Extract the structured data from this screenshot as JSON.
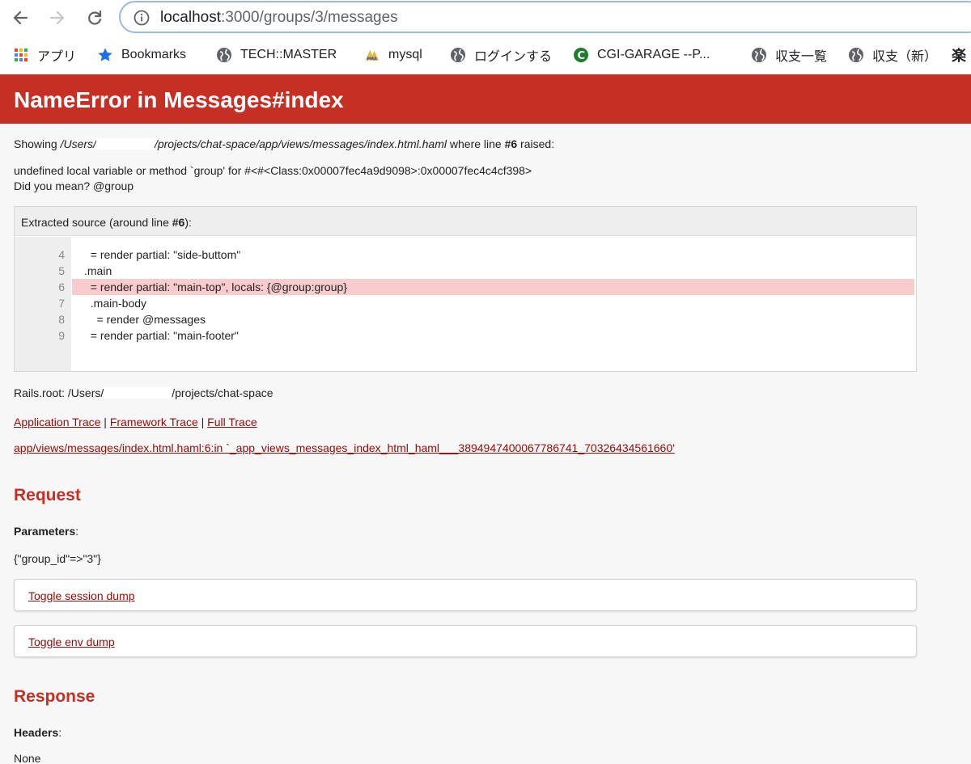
{
  "browser": {
    "url_host": "localhost",
    "url_rest": ":3000/groups/3/messages",
    "bookmarks": [
      {
        "label": "アプリ",
        "icon": "apps-grid-icon"
      },
      {
        "label": "Bookmarks",
        "icon": "star-icon"
      },
      {
        "label": "TECH::MASTER",
        "icon": "globe-icon"
      },
      {
        "label": "mysql",
        "icon": "phpmyadmin-icon"
      },
      {
        "label": "ログインする",
        "icon": "globe-icon"
      },
      {
        "label": "CGI-GARAGE --P...",
        "icon": "cgi-garage-icon"
      },
      {
        "label": "収支一覧",
        "icon": "globe-icon"
      },
      {
        "label": "収支（新）",
        "icon": "globe-icon"
      },
      {
        "label": "楽",
        "icon": "rakuten-icon"
      }
    ]
  },
  "error": {
    "title": "NameError in Messages#index",
    "showing_prefix": "Showing ",
    "path_start": "/Users/",
    "path_end": "/projects/chat-space/app/views/messages/index.html.haml",
    "where_text": " where line ",
    "line_ref": "#6",
    "raised_text": " raised:",
    "message": "undefined local variable or method `group' for #<#<Class:0x00007fec4a9d9098>:0x00007fec4c4cf398>",
    "did_you_mean": "Did you mean?  @group"
  },
  "source": {
    "heading_prefix": "Extracted source (around line ",
    "heading_line": "#6",
    "heading_suffix": "):",
    "lines": [
      {
        "num": "4",
        "code": "  = render partial: \"side-buttom\""
      },
      {
        "num": "5",
        "code": ".main"
      },
      {
        "num": "6",
        "code": "  = render partial: \"main-top\", locals: {@group:group}"
      },
      {
        "num": "7",
        "code": "  .main-body"
      },
      {
        "num": "8",
        "code": "    = render @messages"
      },
      {
        "num": "9",
        "code": "  = render partial: \"main-footer\""
      }
    ],
    "highlighted_line": "6"
  },
  "rails_root": {
    "prefix": "Rails.root: /Users/",
    "suffix": "/projects/chat-space"
  },
  "trace": {
    "application": "Application Trace",
    "framework": "Framework Trace",
    "full": "Full Trace",
    "separator": "|",
    "entry": "app/views/messages/index.html.haml:6:in `_app_views_messages_index_html_haml___3894947400067786741_70326434561660'"
  },
  "request": {
    "heading": "Request",
    "parameters_label": "Parameters",
    "parameters_colon": ":",
    "parameters_value": "{\"group_id\"=>\"3\"}",
    "toggle_session": "Toggle session dump",
    "toggle_env": "Toggle env dump"
  },
  "response": {
    "heading": "Response",
    "headers_label": "Headers",
    "headers_colon": ":",
    "headers_value": "None"
  },
  "colors": {
    "header_bg": "#c52f24",
    "highlight_bg": "#f8cccc",
    "link": "#980905"
  }
}
